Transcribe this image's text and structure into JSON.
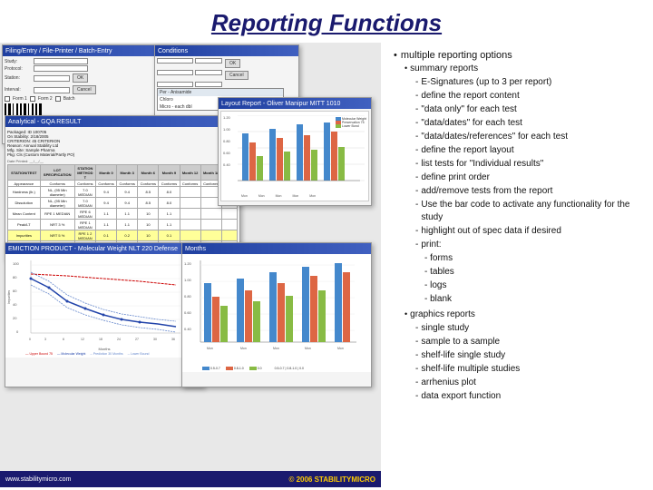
{
  "title": "Reporting Functions",
  "left_panel": {
    "screens": [
      {
        "id": "screen1",
        "title": "Filing/Entry / File-Printer / Batch-Entry",
        "type": "form"
      },
      {
        "id": "screen2",
        "title": "Conditions",
        "type": "dialog"
      },
      {
        "id": "screen3",
        "title": "Analytical - GQA RESULT",
        "type": "table"
      },
      {
        "id": "screen4",
        "title": "Layout Report",
        "type": "chart_bar"
      },
      {
        "id": "screen5",
        "title": "EMICTION PRODUCT",
        "type": "chart_line"
      },
      {
        "id": "screen6",
        "title": "Months",
        "type": "chart_bar2"
      }
    ]
  },
  "bullet_points": {
    "main_label": "multiple reporting options",
    "sections": [
      {
        "label": "summary reports",
        "sub": [
          {
            "label": "E-Signatures (up to 3 per report)",
            "sub": []
          },
          {
            "label": "define the report content",
            "sub": []
          },
          {
            "label": "\"data only\" for each test",
            "sub": []
          },
          {
            "label": "\"data/dates\" for each test",
            "sub": []
          },
          {
            "label": "\"data/dates/references\" for each test",
            "sub": []
          },
          {
            "label": "define the report layout",
            "sub": []
          },
          {
            "label": "list tests for \"Individual results\"",
            "sub": []
          },
          {
            "label": "define print order",
            "sub": []
          },
          {
            "label": "add/remove tests from the report",
            "sub": []
          },
          {
            "label": "Use the bar code to activate any functionality for the study",
            "sub": []
          },
          {
            "label": "highlight out of spec data if desired",
            "sub": []
          },
          {
            "label": "print:",
            "sub": [
              "forms",
              "tables",
              "logs",
              "blank"
            ]
          }
        ]
      },
      {
        "label": "graphics reports",
        "sub": [
          {
            "label": "single study",
            "sub": []
          },
          {
            "label": "sample to a sample",
            "sub": []
          },
          {
            "label": "shelf-life single study",
            "sub": []
          },
          {
            "label": "shelf-life multiple studies",
            "sub": []
          },
          {
            "label": "arrhenius plot",
            "sub": []
          },
          {
            "label": "data export function",
            "sub": []
          }
        ]
      }
    ]
  },
  "footer": {
    "left": "www.stabilitymicro.com",
    "right": "© 2006 STABILITYMICRO"
  }
}
